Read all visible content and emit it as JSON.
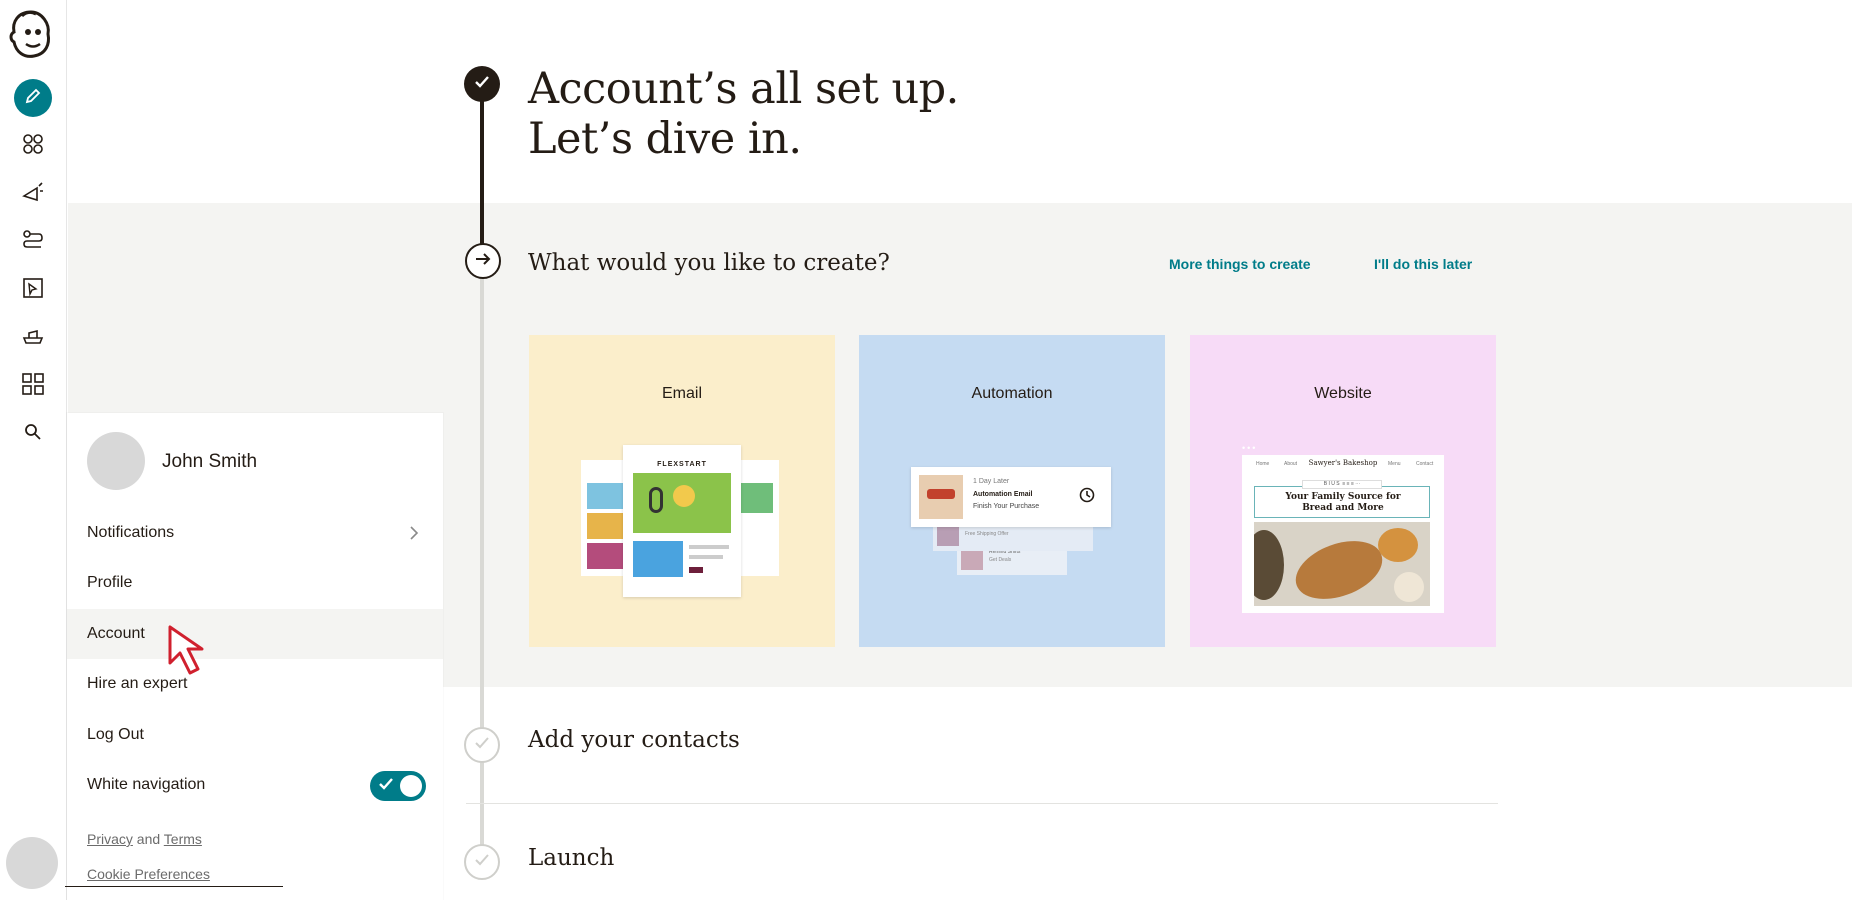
{
  "headline": {
    "line1": "Account’s all set up.",
    "line2": "Let’s dive in."
  },
  "create_step": {
    "title": "What would you like to create?",
    "more_link": "More things to create",
    "later_link": "I'll do this later"
  },
  "cards": [
    {
      "label": "Email"
    },
    {
      "label": "Automation"
    },
    {
      "label": "Website"
    }
  ],
  "email_preview": {
    "brand": "FLEXSTART"
  },
  "automation_preview": {
    "delay": "1 Day Later",
    "title": "Automation Email",
    "subtitle": "Finish Your Purchase",
    "row2_title": "Automation Email",
    "row2_sub": "Free Shipping Offer",
    "row3_title": "Remind Shirts",
    "row3_sub": "Get Deals"
  },
  "website_preview": {
    "nav": [
      "Home",
      "About"
    ],
    "site_name": "Sawyer's Bakeshop",
    "nav_right": [
      "Menu",
      "Contact"
    ],
    "hero_line1": "Your Family Source for",
    "hero_line2": "Bread and More"
  },
  "steps": {
    "contacts": "Add your contacts",
    "launch": "Launch"
  },
  "menu": {
    "username": "John Smith",
    "items": [
      {
        "label": "Notifications"
      },
      {
        "label": "Profile"
      },
      {
        "label": "Account"
      },
      {
        "label": "Hire an expert"
      },
      {
        "label": "Log Out"
      },
      {
        "label": "White navigation"
      }
    ],
    "white_navigation_on": true,
    "privacy": "Privacy",
    "and": "and",
    "terms": "Terms",
    "cookie": "Cookie Preferences"
  },
  "colors": {
    "accent": "#007c89",
    "ink": "#241c15",
    "band": "#f4f4f2",
    "email_card": "#fbeecb",
    "automation_card": "#c5dbf2",
    "website_card": "#f7dbf7"
  },
  "rail_icons": [
    "mailchimp-logo",
    "pencil-icon",
    "audience-icon",
    "megaphone-icon",
    "automation-icon",
    "website-icon",
    "integrations-icon",
    "apps-grid-icon",
    "search-icon"
  ]
}
